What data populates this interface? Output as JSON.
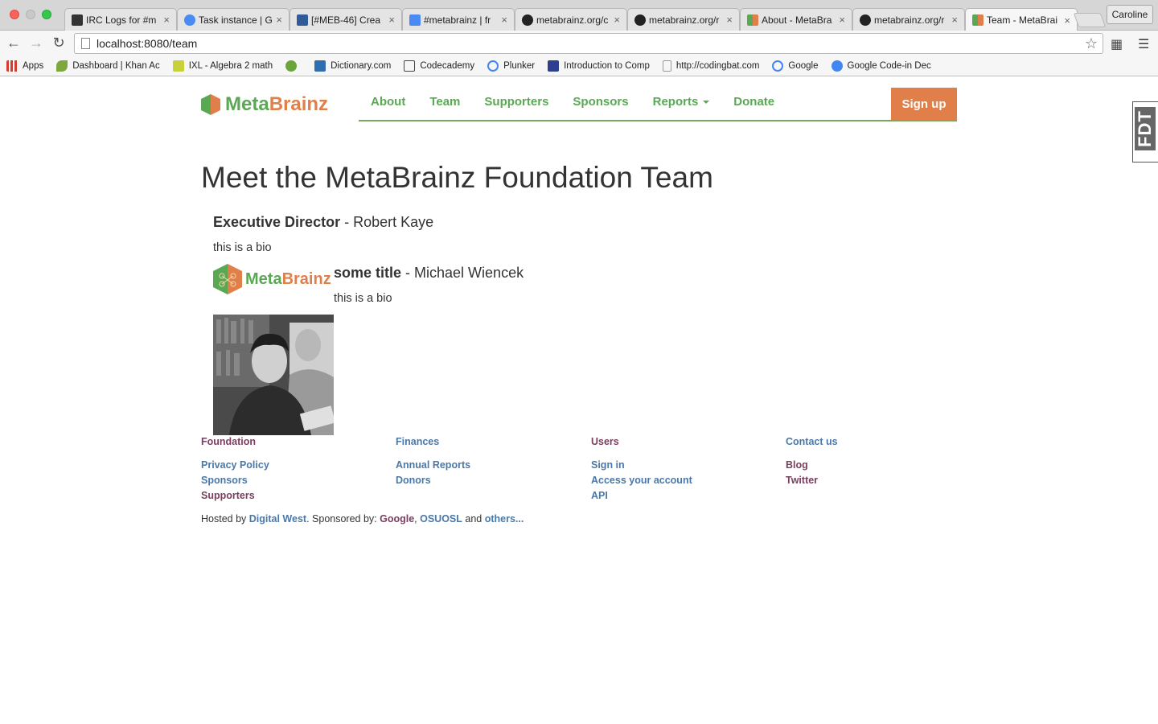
{
  "browser": {
    "tabs": [
      {
        "title": "IRC Logs for #m",
        "favicon_color": "#333333"
      },
      {
        "title": "Task instance | G",
        "favicon_color": "#4a8af4"
      },
      {
        "title": "[#MEB-46] Crea",
        "favicon_color": "#2f5b9a"
      },
      {
        "title": "#metabrainz | fr",
        "favicon_color": "#4a8af4"
      },
      {
        "title": "metabrainz.org/c",
        "favicon_color": "#222222"
      },
      {
        "title": "metabrainz.org/r",
        "favicon_color": "#222222"
      },
      {
        "title": "About - MetaBra",
        "favicon_color": "#e07f49"
      },
      {
        "title": "metabrainz.org/r",
        "favicon_color": "#222222"
      },
      {
        "title": "Team - MetaBrai",
        "favicon_color": "#e07f49"
      }
    ],
    "active_tab_index": 8,
    "close_glyph": "×",
    "profile_name": "Caroline",
    "url": "localhost:8080/team",
    "bookmarks": [
      {
        "label": "Apps",
        "icon_color": "#d23f31"
      },
      {
        "label": "Dashboard | Khan Ac",
        "icon_color": "#7ea83e"
      },
      {
        "label": "IXL - Algebra 2 math",
        "icon_color": "#c9d13a"
      },
      {
        "label": "",
        "icon_color": "#6aa53a"
      },
      {
        "label": "Dictionary.com",
        "icon_color": "#2f6fb0"
      },
      {
        "label": "Codecademy",
        "icon_color": "#444444"
      },
      {
        "label": "Plunker",
        "icon_color": "#4285f4"
      },
      {
        "label": "Introduction to Comp",
        "icon_color": "#2f3f8f"
      },
      {
        "label": "http://codingbat.com",
        "icon_color": "#999999"
      },
      {
        "label": "Google",
        "icon_color": "#4285f4"
      },
      {
        "label": "Google Code-in Dec",
        "icon_color": "#4285f4"
      }
    ]
  },
  "site": {
    "brand_part1": "Meta",
    "brand_part2": "Brainz",
    "nav": [
      "About",
      "Team",
      "Supporters",
      "Sponsors",
      "Reports",
      "Donate"
    ],
    "signup_label": "Sign up",
    "fdt_label": "FDT",
    "colors": {
      "green": "#5aa854",
      "orange": "#e07f49",
      "link_blue": "#4a78a8",
      "link_purple": "#7a3e5e"
    }
  },
  "team": {
    "heading": "Meet the MetaBrainz Foundation Team",
    "members": [
      {
        "role": "Executive Director",
        "sep": " - ",
        "name": "Robert Kaye",
        "bio": "this is a bio"
      },
      {
        "role": "some title",
        "sep": " - ",
        "name": "Michael Wiencek",
        "bio": "this is a bio"
      }
    ],
    "logo_part1": "Meta",
    "logo_part2": "Brainz"
  },
  "footer": {
    "columns": [
      {
        "heading": "Foundation",
        "links": [
          "Privacy Policy",
          "Sponsors",
          "Supporters"
        ]
      },
      {
        "heading": "Finances",
        "links": [
          "Annual Reports",
          "Donors"
        ]
      },
      {
        "heading": "Users",
        "links": [
          "Sign in",
          "Access your account",
          "API"
        ]
      },
      {
        "heading": "Contact us",
        "links": [
          "Blog",
          "Twitter"
        ]
      }
    ],
    "hosted_prefix": "Hosted by ",
    "host_link": "Digital West",
    "sponsored_text": ". Sponsored by: ",
    "sponsor1": "Google",
    "comma": ", ",
    "sponsor2": "OSUOSL",
    "and_text": " and ",
    "others_link": "others..."
  }
}
